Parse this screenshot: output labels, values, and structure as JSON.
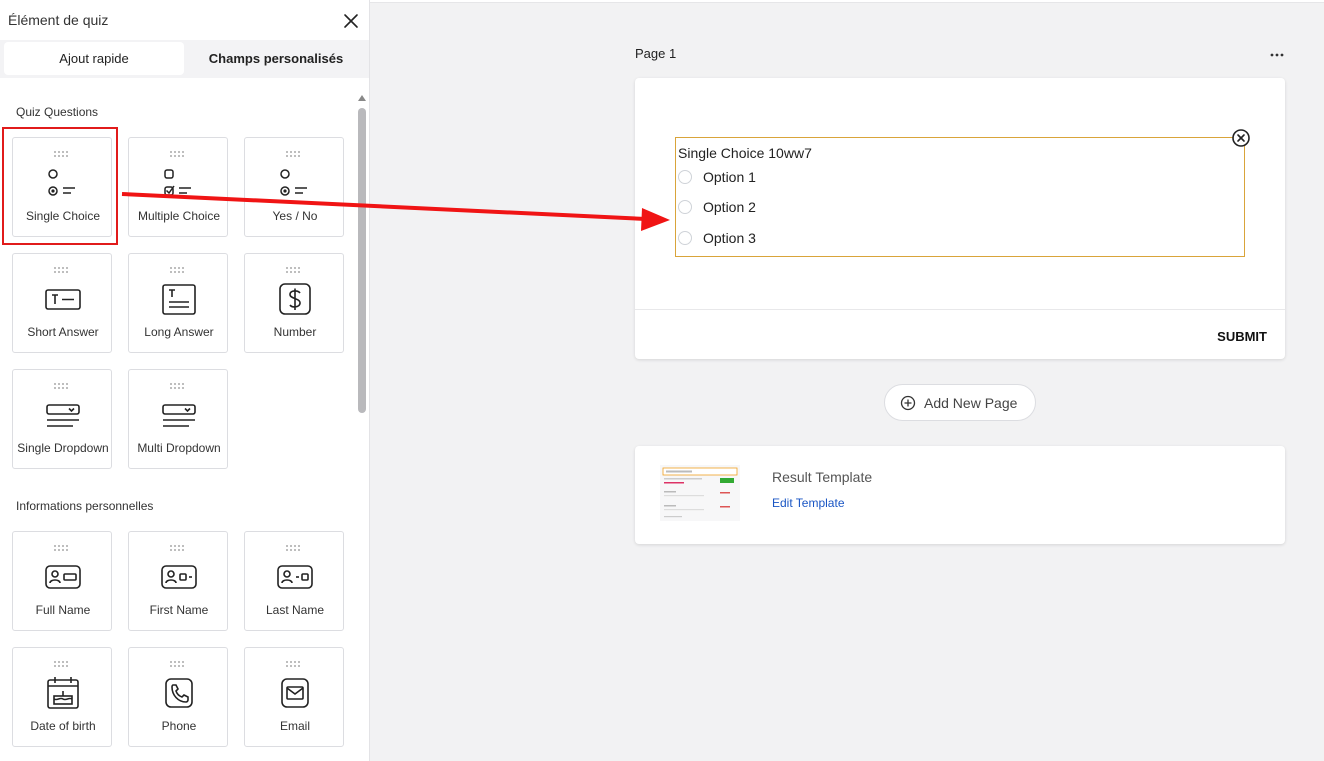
{
  "panel": {
    "title": "Élément de quiz",
    "tabs": [
      {
        "label": "Ajout rapide",
        "active": true
      },
      {
        "label": "Champs personalisés",
        "active": false
      }
    ],
    "sections": [
      {
        "title": "Quiz Questions",
        "items": [
          {
            "label": "Single Choice",
            "icon": "single-choice-icon",
            "highlighted": true
          },
          {
            "label": "Multiple Choice",
            "icon": "multiple-choice-icon"
          },
          {
            "label": "Yes / No",
            "icon": "yes-no-icon"
          },
          {
            "label": "Short Answer",
            "icon": "short-answer-icon"
          },
          {
            "label": "Long Answer",
            "icon": "long-answer-icon"
          },
          {
            "label": "Number",
            "icon": "dollar-icon"
          },
          {
            "label": "Single Dropdown",
            "icon": "dropdown-icon"
          },
          {
            "label": "Multi Dropdown",
            "icon": "dropdown-icon"
          }
        ]
      },
      {
        "title": "Informations personnelles",
        "items": [
          {
            "label": "Full Name",
            "icon": "id-card-icon"
          },
          {
            "label": "First Name",
            "icon": "id-card-icon"
          },
          {
            "label": "Last Name",
            "icon": "id-card-icon"
          },
          {
            "label": "Date of birth",
            "icon": "calendar-cake-icon"
          },
          {
            "label": "Phone",
            "icon": "phone-icon"
          },
          {
            "label": "Email",
            "icon": "mail-icon"
          }
        ]
      }
    ]
  },
  "page": {
    "label": "Page 1",
    "question": {
      "title": "Single Choice 10ww7",
      "options": [
        "Option 1",
        "Option 2",
        "Option 3"
      ]
    },
    "submit_label": "SUBMIT"
  },
  "add_page_label": "Add New Page",
  "result": {
    "title": "Result Template",
    "edit_label": "Edit Template"
  },
  "colors": {
    "highlight": "#e11b1b",
    "question_border": "#d9a43a",
    "link": "#1a56c4"
  }
}
